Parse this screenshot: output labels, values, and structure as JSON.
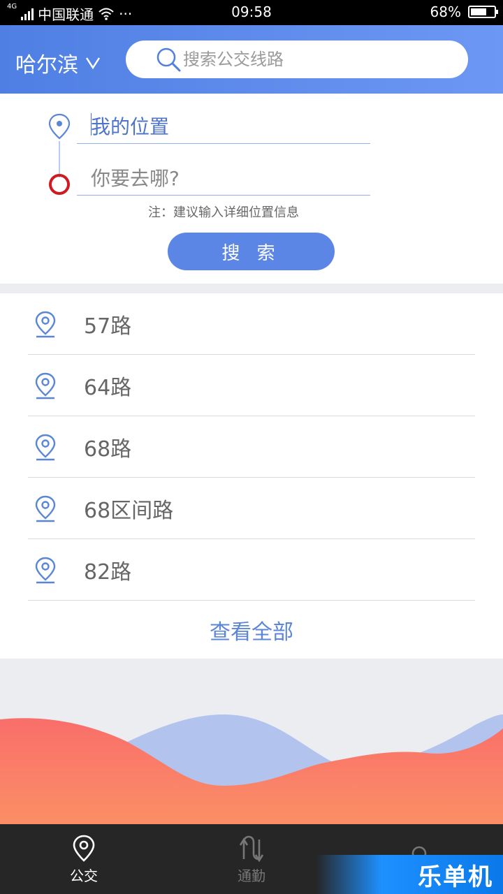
{
  "status_bar": {
    "network_type": "4G",
    "carrier": "中国联通",
    "more": "···",
    "time": "09:58",
    "battery_percent": "68%",
    "battery_level": 0.68
  },
  "header": {
    "city": "哈尔滨",
    "search_placeholder": "搜索公交线路",
    "accent_color": "#5b86e5"
  },
  "route_planner": {
    "start_text": "我的位置",
    "destination_placeholder": "你要去哪?",
    "note": "注：建议输入详细位置信息",
    "search_button": "搜 索"
  },
  "bus_lines": [
    {
      "label": "57路",
      "icon": "location-pin-icon"
    },
    {
      "label": "64路",
      "icon": "location-pin-icon"
    },
    {
      "label": "68路",
      "icon": "location-pin-icon"
    },
    {
      "label": "68区间路",
      "icon": "location-pin-icon"
    },
    {
      "label": "82路",
      "icon": "location-pin-icon"
    }
  ],
  "view_all": "查看全部",
  "bottom_nav": {
    "tabs": [
      {
        "label": "公交",
        "icon": "bus-stop-pin-icon",
        "active": true
      },
      {
        "label": "通勤",
        "icon": "commute-arrows-icon",
        "active": false
      },
      {
        "label": "",
        "icon": "user-icon",
        "active": false
      }
    ]
  },
  "watermark": "乐单机"
}
